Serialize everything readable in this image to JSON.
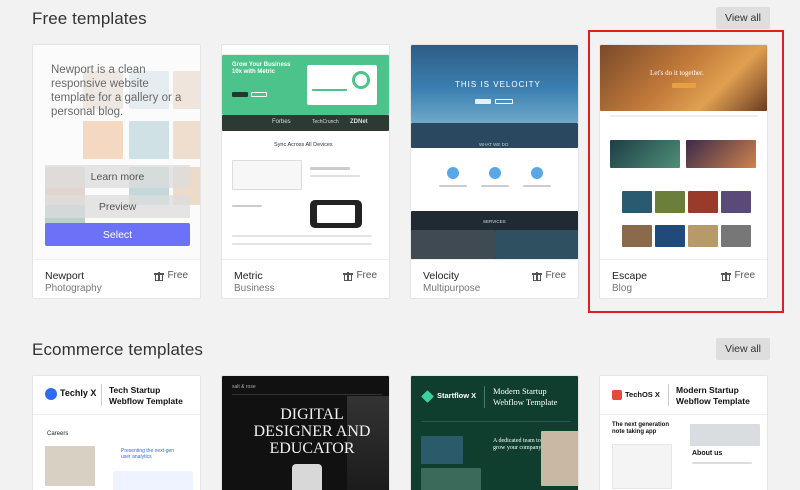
{
  "sections": [
    {
      "title": "Free templates",
      "view_all": "View all"
    },
    {
      "title": "Ecommerce templates",
      "view_all": "View all"
    }
  ],
  "free_cards": [
    {
      "name": "Newport",
      "category": "Photography",
      "price": "Free"
    },
    {
      "name": "Metric",
      "category": "Business",
      "price": "Free"
    },
    {
      "name": "Velocity",
      "category": "Multipurpose",
      "price": "Free"
    },
    {
      "name": "Escape",
      "category": "Blog",
      "price": "Free"
    }
  ],
  "newport_overlay": {
    "description": "Newport is a clean responsive website template for a gallery or a personal blog.",
    "learn_more": "Learn more",
    "preview": "Preview",
    "select": "Select"
  },
  "metric_thumb": {
    "headline": "Grow Your Business 10x with Metric",
    "logos": [
      "Forbes",
      "TechCrunch",
      "ZDNet"
    ],
    "section": "Sync Across All Devices"
  },
  "velocity_thumb": {
    "hero": "THIS IS VELOCITY",
    "what": "WHAT WE DO",
    "services": "SERVICES"
  },
  "escape_thumb": {
    "hero": "Let's do it together."
  },
  "ecommerce_cards": [
    {
      "brand": "Techly X",
      "title": "Tech Startup Webflow Template",
      "sub": "Careers",
      "tag": "Presenting the next-gen user analytics"
    },
    {
      "brand": "salt & rose",
      "title": "DIGITAL DESIGNER AND EDUCATOR"
    },
    {
      "brand": "Startflow X",
      "title": "Modern Startup Webflow Template",
      "sub": "A dedicated team to grow your company"
    },
    {
      "brand": "TechOS X",
      "title": "Modern Startup Webflow Template",
      "sub": "The next generation note taking app",
      "tag": "About us"
    }
  ],
  "colors": {
    "accent": "#6b72f7",
    "highlight": "#e02020",
    "metric_green": "#4cc38a",
    "velocity_blue": "#2f6d9a"
  }
}
